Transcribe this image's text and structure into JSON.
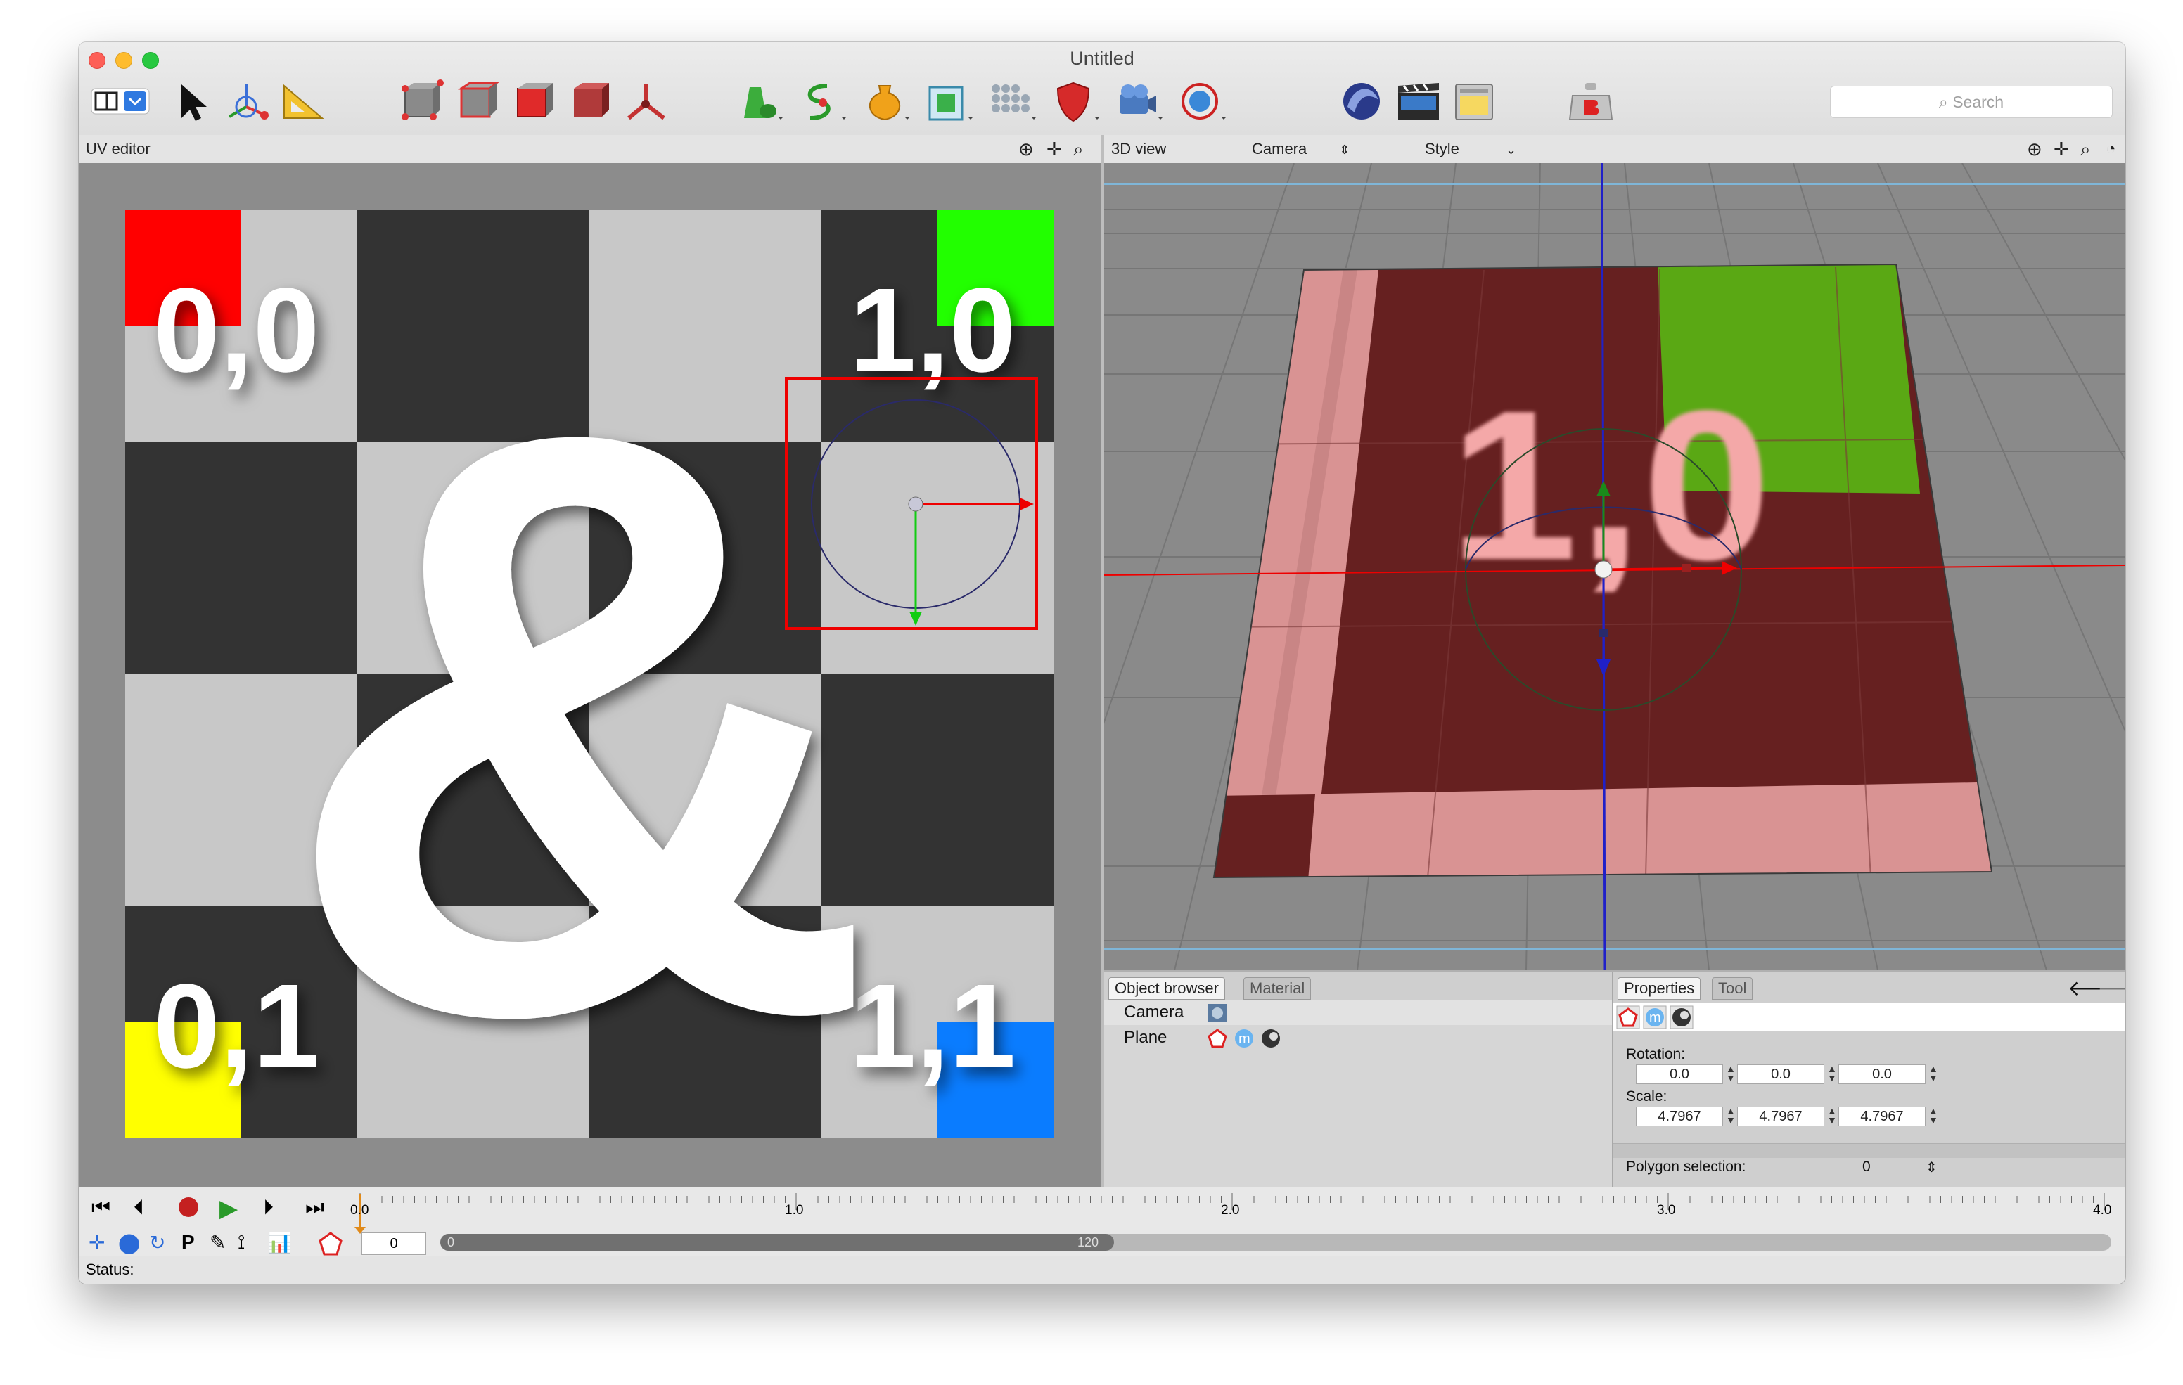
{
  "window": {
    "title": "Untitled"
  },
  "toolbar": {
    "search_placeholder": "Search"
  },
  "uv_editor": {
    "header_label": "UV editor",
    "corner_labels": [
      "0,0",
      "1,0",
      "0,1",
      "1,1"
    ],
    "center_glyph": "&"
  },
  "view3d": {
    "header_label": "3D view",
    "camera_select": "Camera",
    "style_select": "Style",
    "texture_text": "1,0"
  },
  "object_browser": {
    "tabs": [
      "Object browser",
      "Material"
    ],
    "items": [
      {
        "name": "Camera",
        "tags": [
          "camera-tag"
        ]
      },
      {
        "name": "Plane",
        "tags": [
          "polygon-tag",
          "material-tag",
          "texture-tag"
        ]
      }
    ]
  },
  "properties": {
    "tabs": [
      "Properties",
      "Tool"
    ],
    "rotation_label": "Rotation:",
    "rotation": [
      "0.0",
      "0.0",
      "0.0"
    ],
    "scale_label": "Scale:",
    "scale": [
      "4.7967",
      "4.7967",
      "4.7967"
    ],
    "polygon_selection_label": "Polygon selection:",
    "polygon_selection_value": "0"
  },
  "timeline": {
    "ticks": [
      "0.0",
      "1.0",
      "2.0",
      "3.0",
      "4.0"
    ],
    "frame_value": "0",
    "range_start": "0",
    "range_end": "120"
  },
  "status": {
    "label": "Status:"
  },
  "colors": {
    "red": "#ff0000",
    "green": "#22ff00",
    "yellow": "#ffff00",
    "blue": "#0a7cff",
    "dark": "#333333",
    "light": "#c8c8c8",
    "plane_dark": "#662020",
    "plane_light": "#d99393"
  }
}
